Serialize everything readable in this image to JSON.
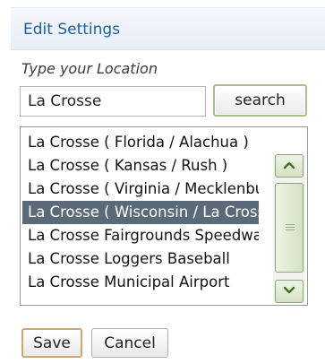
{
  "header": {
    "title": "Edit Settings"
  },
  "location": {
    "label": "Type your Location",
    "value": "La Crosse",
    "search_label": "search"
  },
  "results": {
    "items": [
      "La Crosse ( Florida / Alachua )",
      "La Crosse ( Kansas / Rush )",
      "La Crosse ( Virginia / Mecklenburg )",
      "La Crosse ( Wisconsin / La Crosse )",
      "La Crosse Fairgrounds Speedway",
      "La Crosse Loggers Baseball",
      "La Crosse Municipal Airport"
    ],
    "selected_index": 3,
    "selection_color": "#5b6a78"
  },
  "actions": {
    "save_label": "Save",
    "cancel_label": "Cancel"
  },
  "icons": {
    "scroll_up": "chevron-up-icon",
    "scroll_down": "chevron-down-icon"
  }
}
